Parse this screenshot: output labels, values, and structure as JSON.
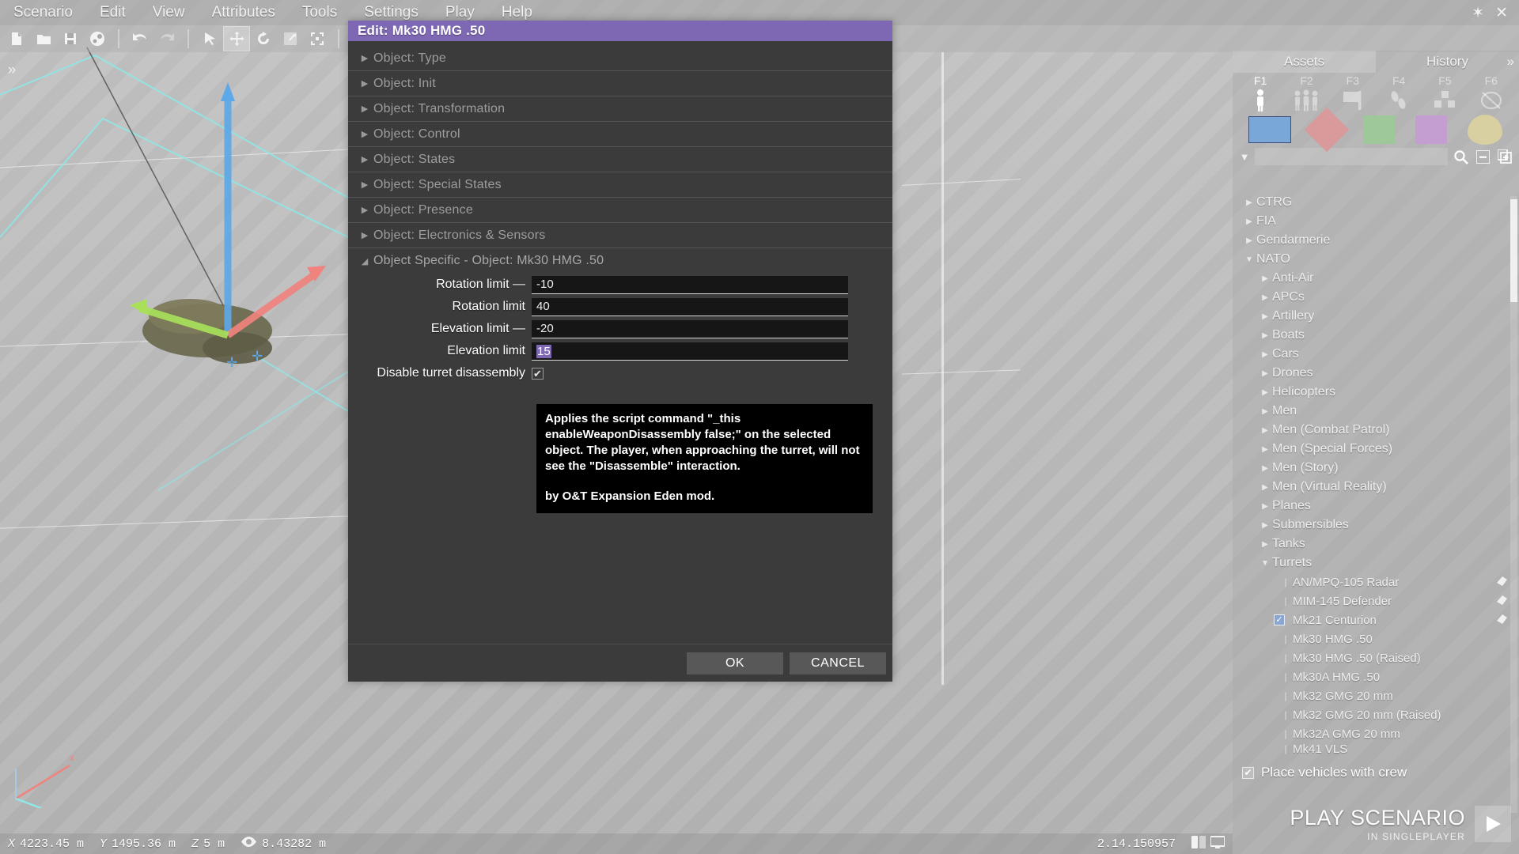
{
  "menubar": {
    "items": [
      "Scenario",
      "Edit",
      "View",
      "Attributes",
      "Tools",
      "Settings",
      "Play",
      "Help"
    ],
    "pin": "✶",
    "close": "✕"
  },
  "toolbar": {
    "icons": [
      "new-file-icon",
      "open-folder-icon",
      "save-icon",
      "steam-icon",
      "undo-icon",
      "redo-icon",
      "select-tool-icon",
      "move-tool-icon",
      "rotate-tool-icon",
      "scale-tool-icon",
      "bounds-tool-icon",
      "globe-icon",
      "envelope-icon",
      "terrain-icon"
    ]
  },
  "dialog": {
    "title": "Edit: Mk30 HMG .50",
    "sections": [
      {
        "label": "Object: Type",
        "open": false
      },
      {
        "label": "Object: Init",
        "open": false
      },
      {
        "label": "Object: Transformation",
        "open": false
      },
      {
        "label": "Object: Control",
        "open": false
      },
      {
        "label": "Object: States",
        "open": false
      },
      {
        "label": "Object: Special States",
        "open": false
      },
      {
        "label": "Object: Presence",
        "open": false
      },
      {
        "label": "Object: Electronics & Sensors",
        "open": false
      },
      {
        "label": "Object Specific - Object: Mk30 HMG .50",
        "open": true
      }
    ],
    "fields": [
      {
        "label": "Rotation limit —",
        "value": "-10",
        "selected": false
      },
      {
        "label": "Rotation limit",
        "value": "40",
        "selected": false
      },
      {
        "label": "Elevation limit —",
        "value": "-20",
        "selected": false
      },
      {
        "label": "Elevation limit",
        "value": "15",
        "selected": true
      }
    ],
    "checkbox": {
      "label": "Disable turret disassembly",
      "checked": true,
      "mark": "✔"
    },
    "tooltip": {
      "line1": "Applies the script command \"_this enableWeaponDisassembly false;\" on the selected object. The player, when approaching the turret, will not see the \"Disassemble\" interaction.",
      "line2": "by O&T Expansion Eden mod."
    },
    "buttons": {
      "ok": "OK",
      "cancel": "CANCEL"
    }
  },
  "assets": {
    "tabs": [
      {
        "label": "Assets",
        "active": true
      },
      {
        "label": "History",
        "active": false
      }
    ],
    "expand_chevron": "»",
    "fkeys": [
      {
        "key": "F1",
        "icon": "single-soldier-icon",
        "active": true
      },
      {
        "key": "F2",
        "icon": "group-soldiers-icon",
        "active": false
      },
      {
        "key": "F3",
        "icon": "flag-icon",
        "active": false
      },
      {
        "key": "F4",
        "icon": "footsteps-icon",
        "active": false
      },
      {
        "key": "F5",
        "icon": "modules-cubes-icon",
        "active": false
      },
      {
        "key": "F6",
        "icon": "no-marker-icon",
        "active": false
      }
    ],
    "factions": [
      {
        "name": "blufor-swatch",
        "color": "#79a8d8",
        "selected": true
      },
      {
        "name": "opfor-swatch",
        "color": "#d89a9a",
        "selected": false
      },
      {
        "name": "independent-swatch",
        "color": "#9ec79a",
        "selected": false
      },
      {
        "name": "civilian-swatch",
        "color": "#c49ed0",
        "selected": false
      },
      {
        "name": "empty-swatch",
        "color": "#d8d0a0",
        "selected": false
      }
    ],
    "search": {
      "value": "",
      "placeholder": ""
    },
    "search_icons": [
      "search-icon",
      "collapse-all-icon",
      "copy-icon"
    ],
    "tree": [
      {
        "label": "CTRG",
        "depth": 1,
        "state": "collapsed"
      },
      {
        "label": "FIA",
        "depth": 1,
        "state": "collapsed"
      },
      {
        "label": "Gendarmerie",
        "depth": 1,
        "state": "collapsed"
      },
      {
        "label": "NATO",
        "depth": 1,
        "state": "expanded"
      },
      {
        "label": "Anti-Air",
        "depth": 2,
        "state": "collapsed"
      },
      {
        "label": "APCs",
        "depth": 2,
        "state": "collapsed"
      },
      {
        "label": "Artillery",
        "depth": 2,
        "state": "collapsed"
      },
      {
        "label": "Boats",
        "depth": 2,
        "state": "collapsed"
      },
      {
        "label": "Cars",
        "depth": 2,
        "state": "collapsed"
      },
      {
        "label": "Drones",
        "depth": 2,
        "state": "collapsed"
      },
      {
        "label": "Helicopters",
        "depth": 2,
        "state": "collapsed"
      },
      {
        "label": "Men",
        "depth": 2,
        "state": "collapsed"
      },
      {
        "label": "Men (Combat Patrol)",
        "depth": 2,
        "state": "collapsed"
      },
      {
        "label": "Men (Special Forces)",
        "depth": 2,
        "state": "collapsed"
      },
      {
        "label": "Men (Story)",
        "depth": 2,
        "state": "collapsed"
      },
      {
        "label": "Men (Virtual Reality)",
        "depth": 2,
        "state": "collapsed"
      },
      {
        "label": "Planes",
        "depth": 2,
        "state": "collapsed"
      },
      {
        "label": "Submersibles",
        "depth": 2,
        "state": "collapsed"
      },
      {
        "label": "Tanks",
        "depth": 2,
        "state": "collapsed"
      },
      {
        "label": "Turrets",
        "depth": 2,
        "state": "expanded"
      },
      {
        "label": "AN/MPQ-105 Radar",
        "depth": 3,
        "state": "leaf",
        "badge": true
      },
      {
        "label": "MIM-145 Defender",
        "depth": 3,
        "state": "leaf",
        "badge": true
      },
      {
        "label": "Mk21 Centurion",
        "depth": 3,
        "state": "leaf",
        "badge": true,
        "checked": true
      },
      {
        "label": "Mk30 HMG .50",
        "depth": 3,
        "state": "leaf"
      },
      {
        "label": "Mk30 HMG .50 (Raised)",
        "depth": 3,
        "state": "leaf"
      },
      {
        "label": "Mk30A HMG .50",
        "depth": 3,
        "state": "leaf"
      },
      {
        "label": "Mk32 GMG 20 mm",
        "depth": 3,
        "state": "leaf"
      },
      {
        "label": "Mk32 GMG 20 mm (Raised)",
        "depth": 3,
        "state": "leaf"
      },
      {
        "label": "Mk32A GMG 20 mm",
        "depth": 3,
        "state": "leaf"
      },
      {
        "label": "Mk41 VLS",
        "depth": 3,
        "state": "leaf"
      }
    ],
    "place_crew": {
      "label": "Place vehicles with crew",
      "checked": true,
      "mark": "✔"
    },
    "play": {
      "title": "PLAY SCENARIO",
      "subtitle": "IN SINGLEPLAYER",
      "icon": "play-triangle-icon"
    }
  },
  "statusbar": {
    "x_axis": "X",
    "x_value": "4223.45 m",
    "y_axis": "Y",
    "y_value": "1495.36 m",
    "z_axis": "Z",
    "z_value": "5 m",
    "eye_value": "8.43282 m",
    "version": "2.14.150957",
    "icons": [
      "eye-icon",
      "grid-snap-icon",
      "screen-icon"
    ]
  }
}
